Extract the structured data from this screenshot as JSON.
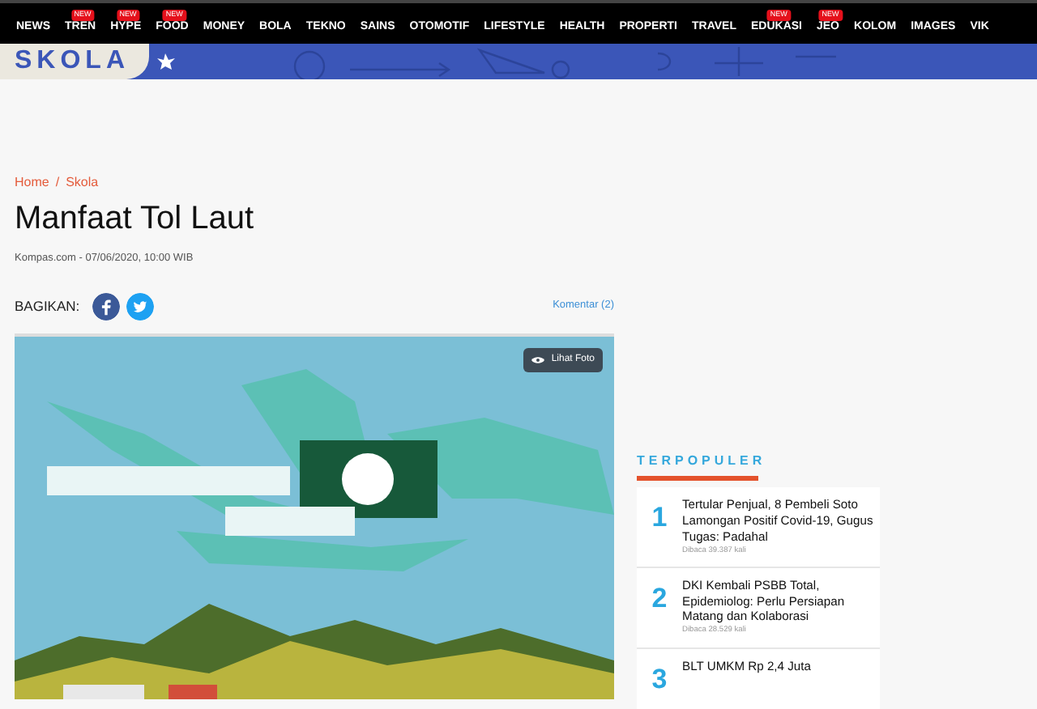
{
  "nav": [
    {
      "label": "NEWS"
    },
    {
      "label": "TREN",
      "badge": "NEW"
    },
    {
      "label": "HYPE",
      "badge": "NEW"
    },
    {
      "label": "FOOD",
      "badge": "NEW"
    },
    {
      "label": "MONEY"
    },
    {
      "label": "BOLA"
    },
    {
      "label": "TEKNO"
    },
    {
      "label": "SAINS"
    },
    {
      "label": "OTOMOTIF"
    },
    {
      "label": "LIFESTYLE"
    },
    {
      "label": "HEALTH"
    },
    {
      "label": "PROPERTI"
    },
    {
      "label": "TRAVEL"
    },
    {
      "label": "EDUKASI",
      "badge": "NEW"
    },
    {
      "label": "JEO",
      "badge": "NEW"
    },
    {
      "label": "KOLOM"
    },
    {
      "label": "IMAGES"
    },
    {
      "label": "VIK"
    }
  ],
  "section_banner": {
    "title": "SKOLA"
  },
  "breadcrumb": {
    "items": [
      "Home",
      "Skola"
    ],
    "separator": "/"
  },
  "article": {
    "title": "Manfaat Tol Laut",
    "meta": "Kompas.com - 07/06/2020, 10:00 WIB",
    "share_label": "BAGIKAN:",
    "comments": "Komentar (2)",
    "photo_button": "Lihat Foto"
  },
  "popular": {
    "heading": "TERPOPULER",
    "items": [
      {
        "rank": "1",
        "title": "Tertular Penjual, 8 Pembeli Soto Lamongan Positif Covid-19, Gugus Tugas: Padahal",
        "reads": "Dibaca 39.387 kali"
      },
      {
        "rank": "2",
        "title": "DKI Kembali PSBB Total, Epidemiolog: Perlu Persiapan Matang dan Kolaborasi",
        "reads": "Dibaca 28.529 kali"
      },
      {
        "rank": "3",
        "title": "BLT UMKM Rp 2,4 Juta"
      }
    ]
  }
}
